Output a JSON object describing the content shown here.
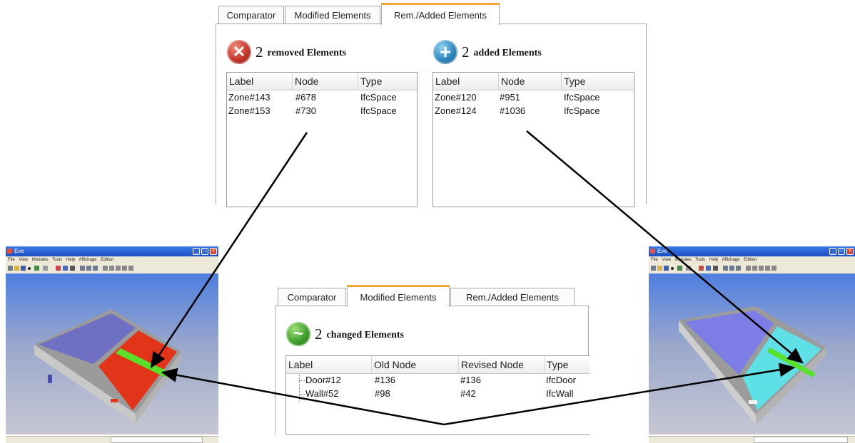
{
  "top_panel": {
    "tabs": [
      {
        "label": "Comparator"
      },
      {
        "label": "Modified Elements"
      },
      {
        "label": "Rem./Added Elements"
      }
    ],
    "removed": {
      "count": "2",
      "text": "removed Elements",
      "icon": "remove-icon",
      "columns": [
        "Label",
        "Node",
        "Type"
      ],
      "rows": [
        {
          "label": "Zone#143",
          "node": "#678",
          "type": "IfcSpace"
        },
        {
          "label": "Zone#153",
          "node": "#730",
          "type": "IfcSpace"
        }
      ]
    },
    "added": {
      "count": "2",
      "text": "added Elements",
      "icon": "add-icon",
      "columns": [
        "Label",
        "Node",
        "Type"
      ],
      "rows": [
        {
          "label": "Zone#120",
          "node": "#951",
          "type": "IfcSpace"
        },
        {
          "label": "Zone#124",
          "node": "#1036",
          "type": "IfcSpace"
        }
      ]
    }
  },
  "middle_panel": {
    "tabs": [
      {
        "label": "Comparator"
      },
      {
        "label": "Modified Elements"
      },
      {
        "label": "Rem./Added Elements"
      }
    ],
    "changed": {
      "count": "2",
      "text": "changed Elements",
      "icon": "changed-icon",
      "columns": [
        "Label",
        "Old Node",
        "Revised Node",
        "Type"
      ],
      "rows": [
        {
          "label": "Door#12",
          "old": "#136",
          "revised": "#136",
          "type": "IfcDoor"
        },
        {
          "label": "Wall#52",
          "old": "#98",
          "revised": "#42",
          "type": "IfcWall"
        }
      ]
    }
  },
  "left_window": {
    "title": "Eve",
    "menu": [
      "File",
      "View",
      "Modules",
      "Tools",
      "Help",
      "Affichage",
      "Edition"
    ],
    "colors": {
      "room_a": "#6f6fc4",
      "room_b": "#e23418",
      "highlight": "#58e02a"
    }
  },
  "right_window": {
    "title": "Eve",
    "menu": [
      "File",
      "View",
      "Modules",
      "Tools",
      "Help",
      "Affichage",
      "Edition"
    ],
    "colors": {
      "room_a": "#7d7de6",
      "room_b": "#5fe0e6",
      "highlight": "#58e02a"
    }
  }
}
